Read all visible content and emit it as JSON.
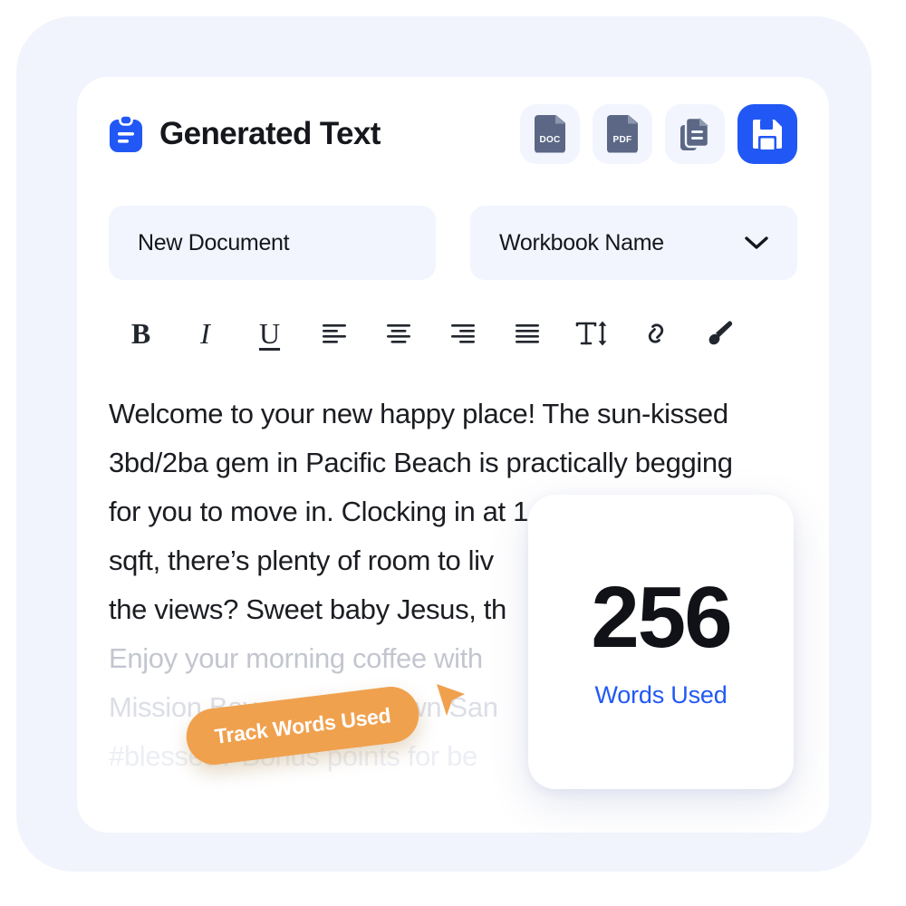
{
  "window": {
    "background_color": "#ffffff",
    "panel_color": "#f2f4fd",
    "card_color": "#ffffff"
  },
  "header": {
    "title": "Generated Text",
    "icon": "clipboard-icon",
    "accent_color": "#2158f5",
    "actions": [
      {
        "name": "export-doc-button",
        "icon": "doc-file-icon",
        "label": "DOC",
        "style": "muted"
      },
      {
        "name": "export-pdf-button",
        "icon": "pdf-file-icon",
        "label": "PDF",
        "style": "muted"
      },
      {
        "name": "copy-button",
        "icon": "copy-docs-icon",
        "label": "",
        "style": "muted"
      },
      {
        "name": "save-button",
        "icon": "floppy-disk-icon",
        "label": "",
        "style": "primary"
      }
    ]
  },
  "fields": {
    "document_name": {
      "value": "New Document",
      "placeholder": "New Document"
    },
    "workbook_select": {
      "value": "Workbook Name",
      "icon": "chevron-down-icon"
    }
  },
  "toolbar": {
    "items": [
      {
        "name": "bold-button",
        "icon": "bold-icon",
        "label": "B"
      },
      {
        "name": "italic-button",
        "icon": "italic-icon",
        "label": "I"
      },
      {
        "name": "underline-button",
        "icon": "underline-icon",
        "label": "U"
      },
      {
        "name": "align-left-button",
        "icon": "align-left-icon",
        "label": ""
      },
      {
        "name": "align-center-button",
        "icon": "align-center-icon",
        "label": ""
      },
      {
        "name": "align-right-button",
        "icon": "align-right-icon",
        "label": ""
      },
      {
        "name": "align-justify-button",
        "icon": "align-justify-icon",
        "label": ""
      },
      {
        "name": "text-size-button",
        "icon": "text-size-icon",
        "label": ""
      },
      {
        "name": "link-button",
        "icon": "link-icon",
        "label": ""
      },
      {
        "name": "highlight-button",
        "icon": "paintbrush-icon",
        "label": ""
      }
    ]
  },
  "document": {
    "lines": [
      {
        "text": "Welcome to your new happy place! The sun-kissed",
        "fade": "none"
      },
      {
        "text": "3bd/2ba gem in Pacific Beach is practically begging",
        "fade": "none"
      },
      {
        "text": "for you to move in. Clocking in at 1,",
        "fade": "none"
      },
      {
        "text": "sqft, there’s plenty of room to liv",
        "fade": "none"
      },
      {
        "text": "the views? Sweet baby Jesus, th",
        "fade": "none"
      },
      {
        "text": "",
        "fade": "none"
      },
      {
        "text": "Enjoy your morning coffee with",
        "fade": "fade1"
      },
      {
        "text": "Mission Bay and downtown San",
        "fade": "fade2"
      },
      {
        "text": "#blessed? Bonus points for be",
        "fade": "fade3"
      }
    ]
  },
  "word_count": {
    "count": "256",
    "label": "Words Used",
    "label_color": "#2158f5"
  },
  "callout": {
    "text": "Track Words Used",
    "color": "#f0a14e",
    "cursor_icon": "cursor-pointer-icon"
  }
}
